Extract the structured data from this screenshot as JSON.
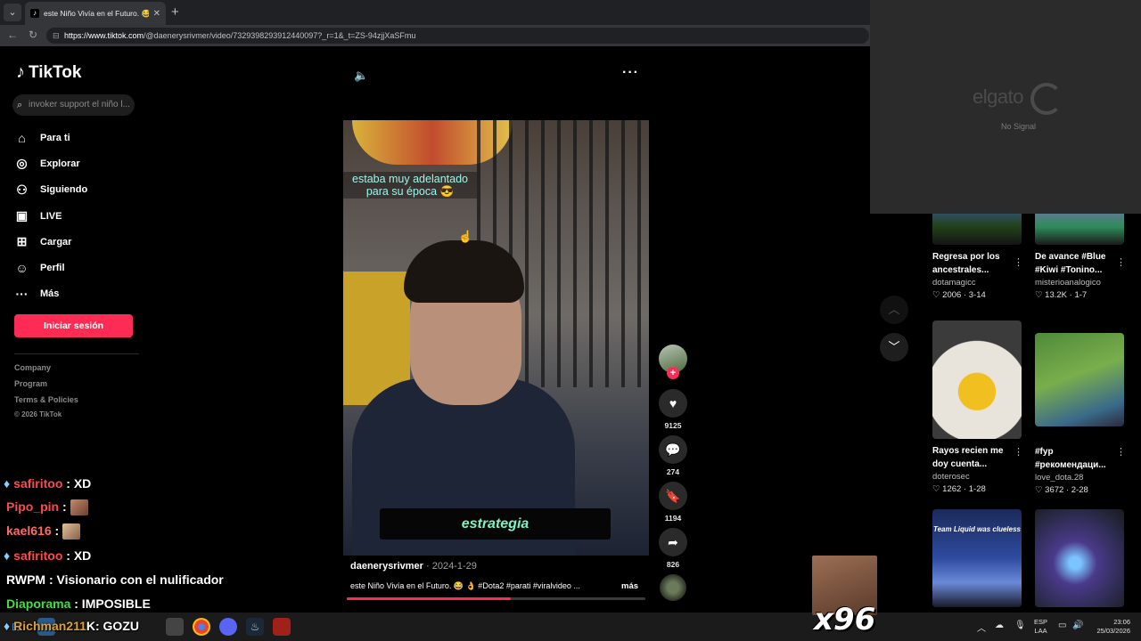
{
  "browser": {
    "tab_title": "este Niño Vivía en el Futuro. 😂 👌",
    "url_host": "https://www.tiktok.com",
    "url_path": "/@daenerysrivmer/video/7329398293912440097?_r=1&_t=ZS-94zjjXaSFmu"
  },
  "sidebar": {
    "logo": "TikTok",
    "search_placeholder": "invoker support el niño l...",
    "items": [
      {
        "icon": "home-icon",
        "label": "Para ti"
      },
      {
        "icon": "compass-icon",
        "label": "Explorar"
      },
      {
        "icon": "following-icon",
        "label": "Siguiendo"
      },
      {
        "icon": "live-icon",
        "label": "LIVE"
      },
      {
        "icon": "upload-icon",
        "label": "Cargar"
      },
      {
        "icon": "profile-icon",
        "label": "Perfil"
      },
      {
        "icon": "more-icon",
        "label": "Más"
      }
    ],
    "login_label": "Iniciar sesión",
    "footer": [
      "Company",
      "Program",
      "Terms & Policies",
      "© 2026 TikTok"
    ]
  },
  "video": {
    "caption_top": "estaba muy adelantado para su época 😎",
    "caption_bottom": "estrategia",
    "author": "daenerysrivmer",
    "date": " · 2024-1-29",
    "description": "este Niño Vivía en el Futuro. 😂 👌 #Dota2 #parati #viralvideo ...",
    "more_label": "más",
    "progress_fraction": 0.55,
    "likes": "9125",
    "comments": "274",
    "saves": "1194",
    "shares": "826"
  },
  "elgato": {
    "brand": "elgato",
    "status": "No Signal"
  },
  "recommended": [
    {
      "title": "Regresa por los ancestrales...",
      "author": "dotamagicc",
      "likes": "2006",
      "date": "3-14"
    },
    {
      "title": "De avance #Blue #Kiwi #Tonino...",
      "author": "misterioanalogico",
      "likes": "13.2K",
      "date": "1-7"
    },
    {
      "title": "Rayos recien me doy cuenta...",
      "author": "doterosec",
      "likes": "1262",
      "date": "1-28"
    },
    {
      "title": "#fyp #рекомендаци...",
      "author": "love_dota.28",
      "likes": "3672",
      "date": "2-28"
    },
    {
      "title": "Team Liquid was clueless",
      "author": "",
      "likes": "",
      "date": ""
    },
    {
      "title": "",
      "author": "",
      "likes": "",
      "date": ""
    }
  ],
  "chat": [
    {
      "user": "safiritoo",
      "message": ": XD",
      "color": "#ff4a4a",
      "gem": true
    },
    {
      "user": "Pipo_pin",
      "message": ":",
      "color": "#ff4a4a",
      "gem": false,
      "emote": true
    },
    {
      "user": "kael616",
      "message": ":",
      "color": "#ff6a6a",
      "gem": false,
      "emote": true
    },
    {
      "user": "safiritoo",
      "message": ": XD",
      "color": "#ff4a4a",
      "gem": true
    },
    {
      "user": "RWPM",
      "message": ": Visionario con el nulificador",
      "color": "#ffffff",
      "gem": false
    },
    {
      "user": "Diaporama",
      "message": ": IMPOSIBLE",
      "color": "#44dd44",
      "gem": false
    },
    {
      "user": "Richman211",
      "message": "K: GOZU",
      "color": "#e0a030",
      "gem": true
    }
  ],
  "overlay": {
    "multiplier": "x96"
  },
  "taskbar": {
    "lang_top": "ESP",
    "lang_bottom": "LAA",
    "time": "23:06",
    "date": "25/03/2026"
  }
}
